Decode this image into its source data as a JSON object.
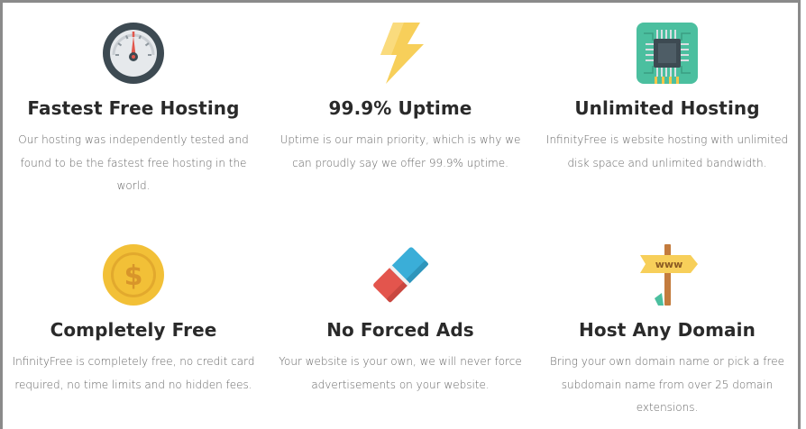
{
  "features": [
    {
      "title": "Fastest Free Hosting",
      "desc": "Our hosting was independently tested and found to be the fastest free hosting in the world.",
      "icon": "speedometer-icon"
    },
    {
      "title": "99.9% Uptime",
      "desc": "Uptime is our main priority, which is why we can proudly say we offer 99.9% uptime.",
      "icon": "lightning-bolt-icon"
    },
    {
      "title": "Unlimited Hosting",
      "desc": "InfinityFree is website hosting with unlimited disk space and unlimited bandwidth.",
      "icon": "cpu-chip-icon"
    },
    {
      "title": "Completely Free",
      "desc": "InfinityFree is completely free, no credit card required, no time limits and no hidden fees.",
      "icon": "dollar-coin-icon"
    },
    {
      "title": "No Forced Ads",
      "desc": "Your website is your own, we will never force advertisements on your website.",
      "icon": "eraser-icon"
    },
    {
      "title": "Host Any Domain",
      "desc": "Bring your own domain name or pick a free subdomain name from over 25 domain extensions.",
      "icon": "www-signpost-icon",
      "sign_text": "www"
    }
  ],
  "colors": {
    "title": "#2a2a2a",
    "text": "#666666",
    "gauge_dark": "#3d4a52",
    "gauge_red": "#e2574c",
    "bolt_yellow": "#f7cf5a",
    "chip_green": "#4bbf9f",
    "coin_gold": "#f2c037",
    "eraser_blue": "#3aaed8",
    "eraser_red": "#e3554d",
    "sign_wood": "#c37b3d"
  }
}
